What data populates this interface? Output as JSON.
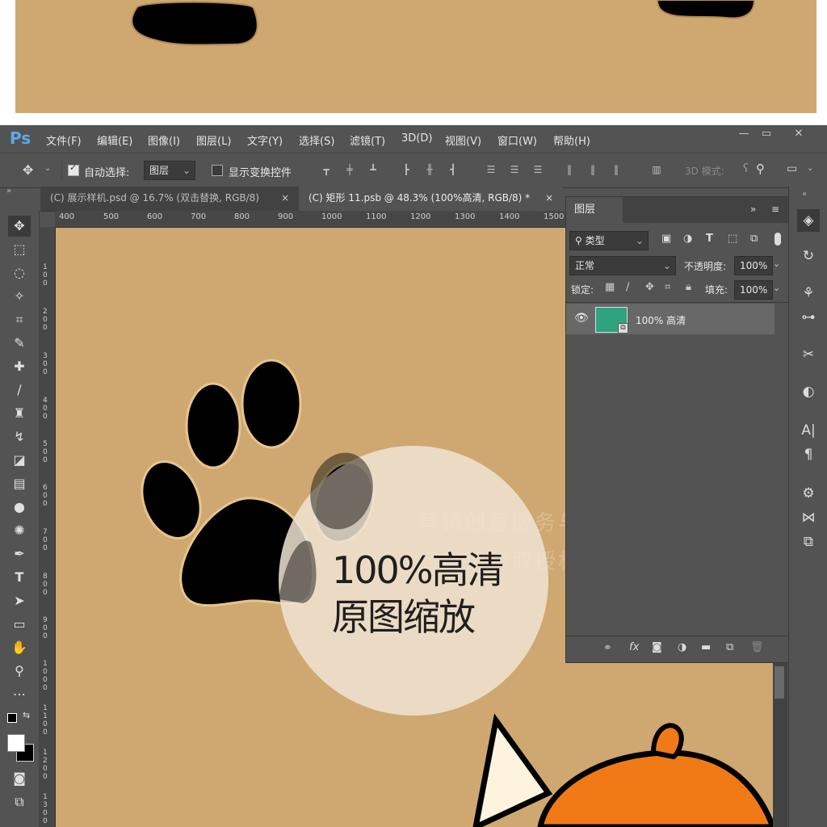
{
  "app": {
    "logo": "Ps"
  },
  "menu": [
    "文件(F)",
    "编辑(E)",
    "图像(I)",
    "图层(L)",
    "文字(Y)",
    "选择(S)",
    "滤镜(T)",
    "3D(D)",
    "视图(V)",
    "窗口(W)",
    "帮助(H)"
  ],
  "options_bar": {
    "auto_select_label": "自动选择:",
    "auto_select_value": "图层",
    "show_transform_label": "显示变换控件",
    "mode_3d_label": "3D 模式:"
  },
  "tabs": [
    {
      "label": "(C) 展示样机.psd @ 16.7% (双击替换, RGB/8)",
      "close": "×"
    },
    {
      "label": "(C) 矩形 11.psb @ 48.3% (100%高清, RGB/8) *",
      "close": "×"
    }
  ],
  "ruler_top": [
    "400",
    "500",
    "600",
    "700",
    "800",
    "900",
    "1000",
    "1100",
    "1200",
    "1300",
    "1400",
    "1500"
  ],
  "ruler_left": [
    "100",
    "200",
    "300",
    "400",
    "500",
    "600",
    "700",
    "800",
    "900",
    "1000",
    "1100",
    "1200",
    "1300"
  ],
  "layers_panel": {
    "title": "图层",
    "filter_label": "类型",
    "blend_mode": "正常",
    "opacity_label": "不透明度:",
    "opacity_value": "100%",
    "lock_label": "锁定:",
    "fill_label": "填充:",
    "fill_value": "100%",
    "layers": [
      {
        "name": "100% 高清",
        "thumb_color": "#2ea37e"
      }
    ]
  },
  "overlay": {
    "line1": "100%高清",
    "line2": "原图缩放"
  },
  "watermark": {
    "line1": "营销创意服务与协作平台",
    "line2": "商用请获取授权"
  },
  "colors": {
    "canvas": "#cfa871",
    "ps_bg": "#535353",
    "accent_layer": "#2ea37e",
    "hat": "#f07a16"
  }
}
